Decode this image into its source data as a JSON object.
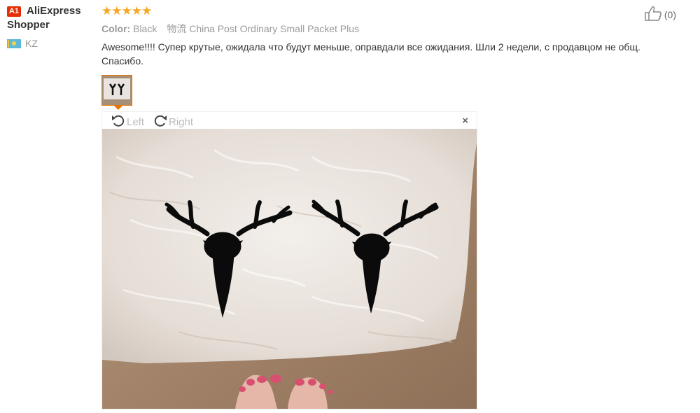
{
  "reviewer": {
    "badge": "A1",
    "name": "AliExpress Shopper",
    "country": "KZ"
  },
  "review": {
    "rating": 5,
    "stars_text": "★★★★★",
    "color_label": "Color:",
    "color_value": "Black",
    "shipping": "物流 China Post Ordinary Small Packet Plus",
    "text": "Awesome!!!! Супер крутые, ожидала что будут меньше, оправдали все ожидания. Шли 2 недели, с продавцом не общ. Спасибо."
  },
  "like": {
    "count_text": "(0)"
  },
  "viewer": {
    "rotate_left_label": "Left",
    "rotate_right_label": "Right",
    "close_label": "×"
  },
  "colors": {
    "accent": "#e77400",
    "badge": "#e62e04",
    "stars": "#f5a623"
  }
}
